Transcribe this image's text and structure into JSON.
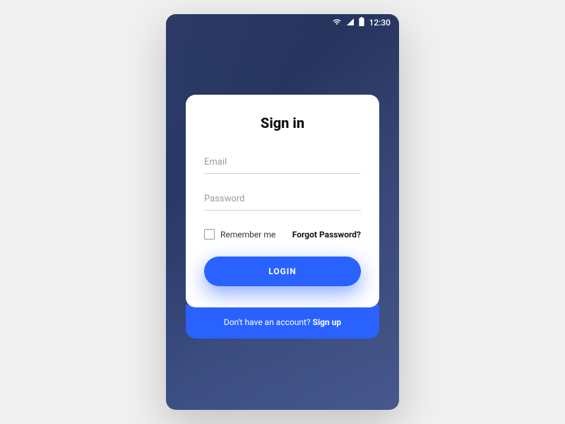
{
  "status_bar": {
    "clock": "12:30"
  },
  "card": {
    "title": "Sign in",
    "email_placeholder": "Email",
    "email_value": "",
    "password_placeholder": "Password",
    "password_value": "",
    "remember_label": "Remember me",
    "forgot_label": "Forgot Password?",
    "login_button": "LOGIN"
  },
  "signup": {
    "prompt": "Don't have an account? ",
    "link": "Sign up"
  },
  "colors": {
    "primary": "#2962ff"
  }
}
